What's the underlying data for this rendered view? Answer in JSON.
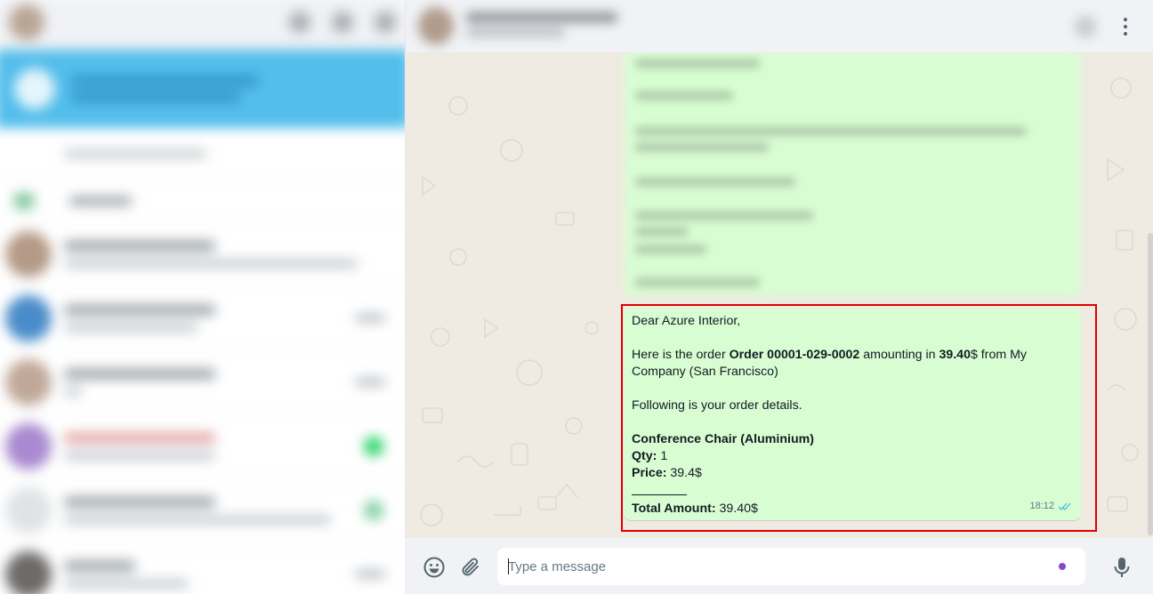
{
  "app": "WhatsApp Web",
  "colors": {
    "accent": "#53bdeb",
    "outgoing_bubble": "#d9fdd3",
    "chat_background": "#efeae2",
    "panel_background": "#f0f2f5",
    "read_ticks": "#53bdeb",
    "highlight_border": "#e00000"
  },
  "sidebar": {
    "blurred": true,
    "chat_rows": 6
  },
  "chat_header": {
    "blurred": true,
    "menu_icon": "kebab-menu-icon"
  },
  "message": {
    "greeting": "Dear Azure Interior,",
    "intro_prefix": "Here is the order ",
    "order_ref": "Order 00001-029-0002",
    "intro_mid": " amounting in ",
    "amount": "39.40",
    "intro_suffix_line1": "$ from My",
    "intro_suffix_line2": "Company (San Francisco)",
    "details_line": "Following is your order details.",
    "product_name": "Conference Chair (Aluminium)",
    "qty_label": "Qty:",
    "qty_value": " 1",
    "price_label": "Price:",
    "price_value": " 39.4$",
    "total_label": "Total Amount:",
    "total_value": " 39.40$",
    "time": "18:12",
    "status_icon": "double-check-read-icon"
  },
  "composer": {
    "placeholder": "Type a message",
    "emoji_icon": "emoji-icon",
    "attach_icon": "paperclip-icon",
    "mic_icon": "microphone-icon"
  }
}
